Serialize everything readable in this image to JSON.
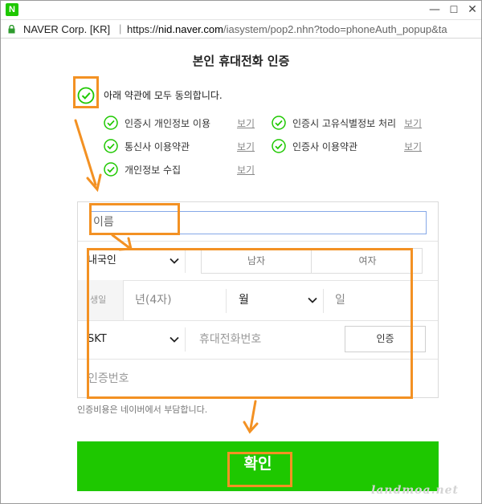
{
  "window": {
    "logo": "N",
    "min": "—",
    "max": "☐",
    "close": "✕"
  },
  "address": {
    "site_label": "NAVER Corp. [KR]",
    "separator": "|",
    "url_scheme": "https://",
    "url_host": "nid.naver.com",
    "url_path": "/iasystem/pop2.nhn?todo=phoneAuth_popup&ta"
  },
  "page": {
    "title": "본인 휴대전화 인증"
  },
  "terms": {
    "all_label": "아래 약관에 모두 동의합니다.",
    "items": [
      {
        "label": "인증시 개인정보 이용",
        "view": "보기"
      },
      {
        "label": "인증시 고유식별정보 처리",
        "view": "보기"
      },
      {
        "label": "통신사 이용약관",
        "view": "보기"
      },
      {
        "label": "인증사 이용약관",
        "view": "보기"
      },
      {
        "label": "개인정보 수집",
        "view": "보기"
      }
    ]
  },
  "form": {
    "name_placeholder": "이름",
    "nationality": "내국인",
    "gender_male": "남자",
    "gender_female": "여자",
    "birth_label": "생일",
    "year_placeholder": "년(4자)",
    "month_label": "월",
    "day_placeholder": "일",
    "carrier": "SKT",
    "phone_placeholder": "휴대전화번호",
    "verify_button": "인증",
    "code_placeholder": "인증번호"
  },
  "fee_note": "인증비용은 네이버에서 부담합니다.",
  "confirm_button": "확인",
  "watermark": "landmoa.net",
  "colors": {
    "accent": "#1ec800",
    "annotation": "#f39123"
  }
}
